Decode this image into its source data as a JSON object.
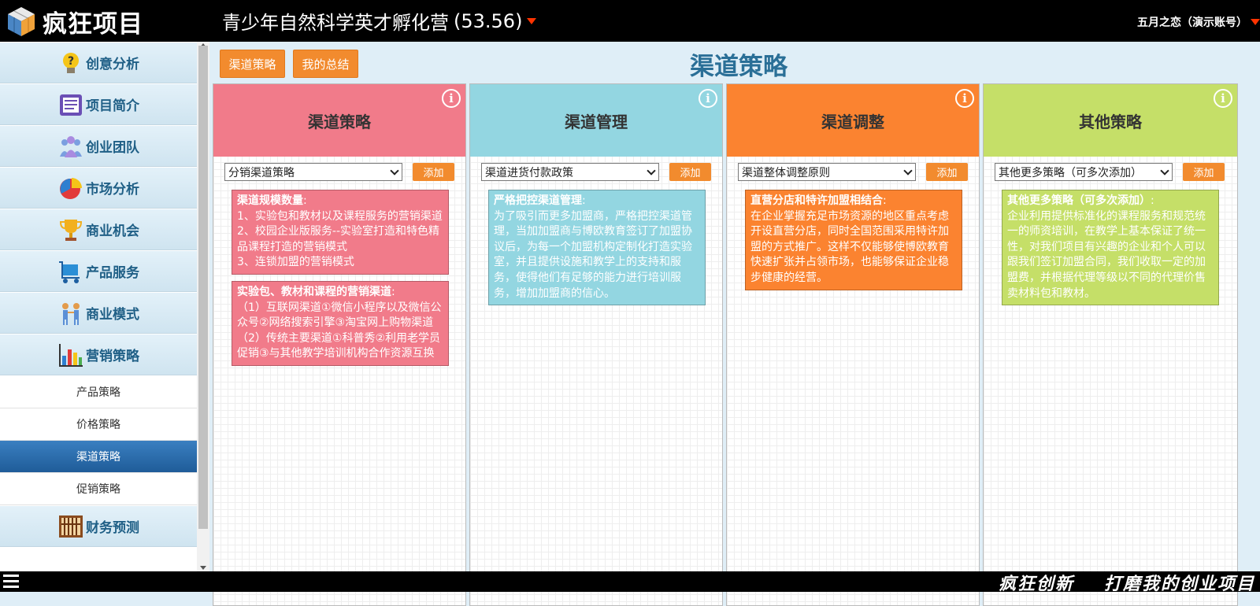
{
  "header": {
    "logo_text": "疯狂项目",
    "project_title": "青少年自然科学英才孵化营",
    "project_score": "(53.56)",
    "user": "五月之恋（演示账号）"
  },
  "sidebar": {
    "items": [
      {
        "label": "创意分析",
        "icon": "lightbulb-question-icon"
      },
      {
        "label": "项目简介",
        "icon": "document-icon"
      },
      {
        "label": "创业团队",
        "icon": "team-icon"
      },
      {
        "label": "市场分析",
        "icon": "pie-chart-icon"
      },
      {
        "label": "商业机会",
        "icon": "trophy-icon"
      },
      {
        "label": "产品服务",
        "icon": "cart-icon"
      },
      {
        "label": "商业模式",
        "icon": "people-icon"
      },
      {
        "label": "营销策略",
        "icon": "bar-chart-icon"
      }
    ],
    "sub_items": [
      "产品策略",
      "价格策略",
      "渠道策略",
      "促销策略"
    ],
    "active_sub": "渠道策略",
    "after_items": [
      {
        "label": "财务预测",
        "icon": "abacus-icon"
      }
    ]
  },
  "main": {
    "buttons": {
      "channel": "渠道策略",
      "summary": "我的总结"
    },
    "title": "渠道策略",
    "columns": [
      {
        "title": "渠道策略",
        "color": "#f17b8a",
        "select": "分销渠道策略",
        "add_label": "添加",
        "cards": [
          {
            "heading": "渠道规模数量",
            "sep": ":",
            "body": "1、实验包和教材以及课程服务的营销渠道\n2、校园企业版服务--实验室打造和特色精品课程打造的营销模式\n3、连锁加盟的营销模式"
          },
          {
            "heading": "实验包、教材和课程的营销渠道",
            "sep": ":",
            "body": "（1）互联网渠道①微信小程序以及微信公众号②网络搜索引擎③淘宝网上购物渠道（2）传统主要渠道①科普秀②利用老学员促销③与其他教学培训机构合作资源互换"
          }
        ]
      },
      {
        "title": "渠道管理",
        "color": "#93d6e1",
        "select": "渠道进货付款政策",
        "add_label": "添加",
        "cards": [
          {
            "heading": "严格把控渠道管理",
            "sep": ":",
            "body": "为了吸引而更多加盟商，严格把控渠道管理，当加加盟商与博欧教育签订了加盟协议后，为每一个加盟机构定制化打造实验室，并且提供设施和教学上的支持和服务，使得他们有足够的能力进行培训服务，增加加盟商的信心。"
          }
        ]
      },
      {
        "title": "渠道调整",
        "color": "#fb8330",
        "select": "渠道整体调整原则",
        "add_label": "添加",
        "cards": [
          {
            "heading": "直营分店和特许加盟相结合",
            "sep": ":",
            "body": "在企业掌握充足市场资源的地区重点考虑开设直营分店，同时全国范围采用特许加盟的方式推广。这样不仅能够使博欧教育快速扩张并占领市场，也能够保证企业稳步健康的经营。"
          }
        ]
      },
      {
        "title": "其他策略",
        "color": "#c5df68",
        "select": "其他更多策略（可多次添加）",
        "add_label": "添加",
        "cards": [
          {
            "heading": "其他更多策略（可多次添加）",
            "sep": ":",
            "body": "企业利用提供标准化的课程服务和规范统一的师资培训，在教学上基本保证了统一性，对我们项目有兴趣的企业和个人可以跟我们签订加盟合同，我们收取一定的加盟费，并根据代理等级以不同的代理价售卖材料包和教材。"
          }
        ]
      }
    ]
  },
  "footer": {
    "slogan_left": "疯狂创新",
    "slogan_right": "打磨我的创业项目"
  }
}
